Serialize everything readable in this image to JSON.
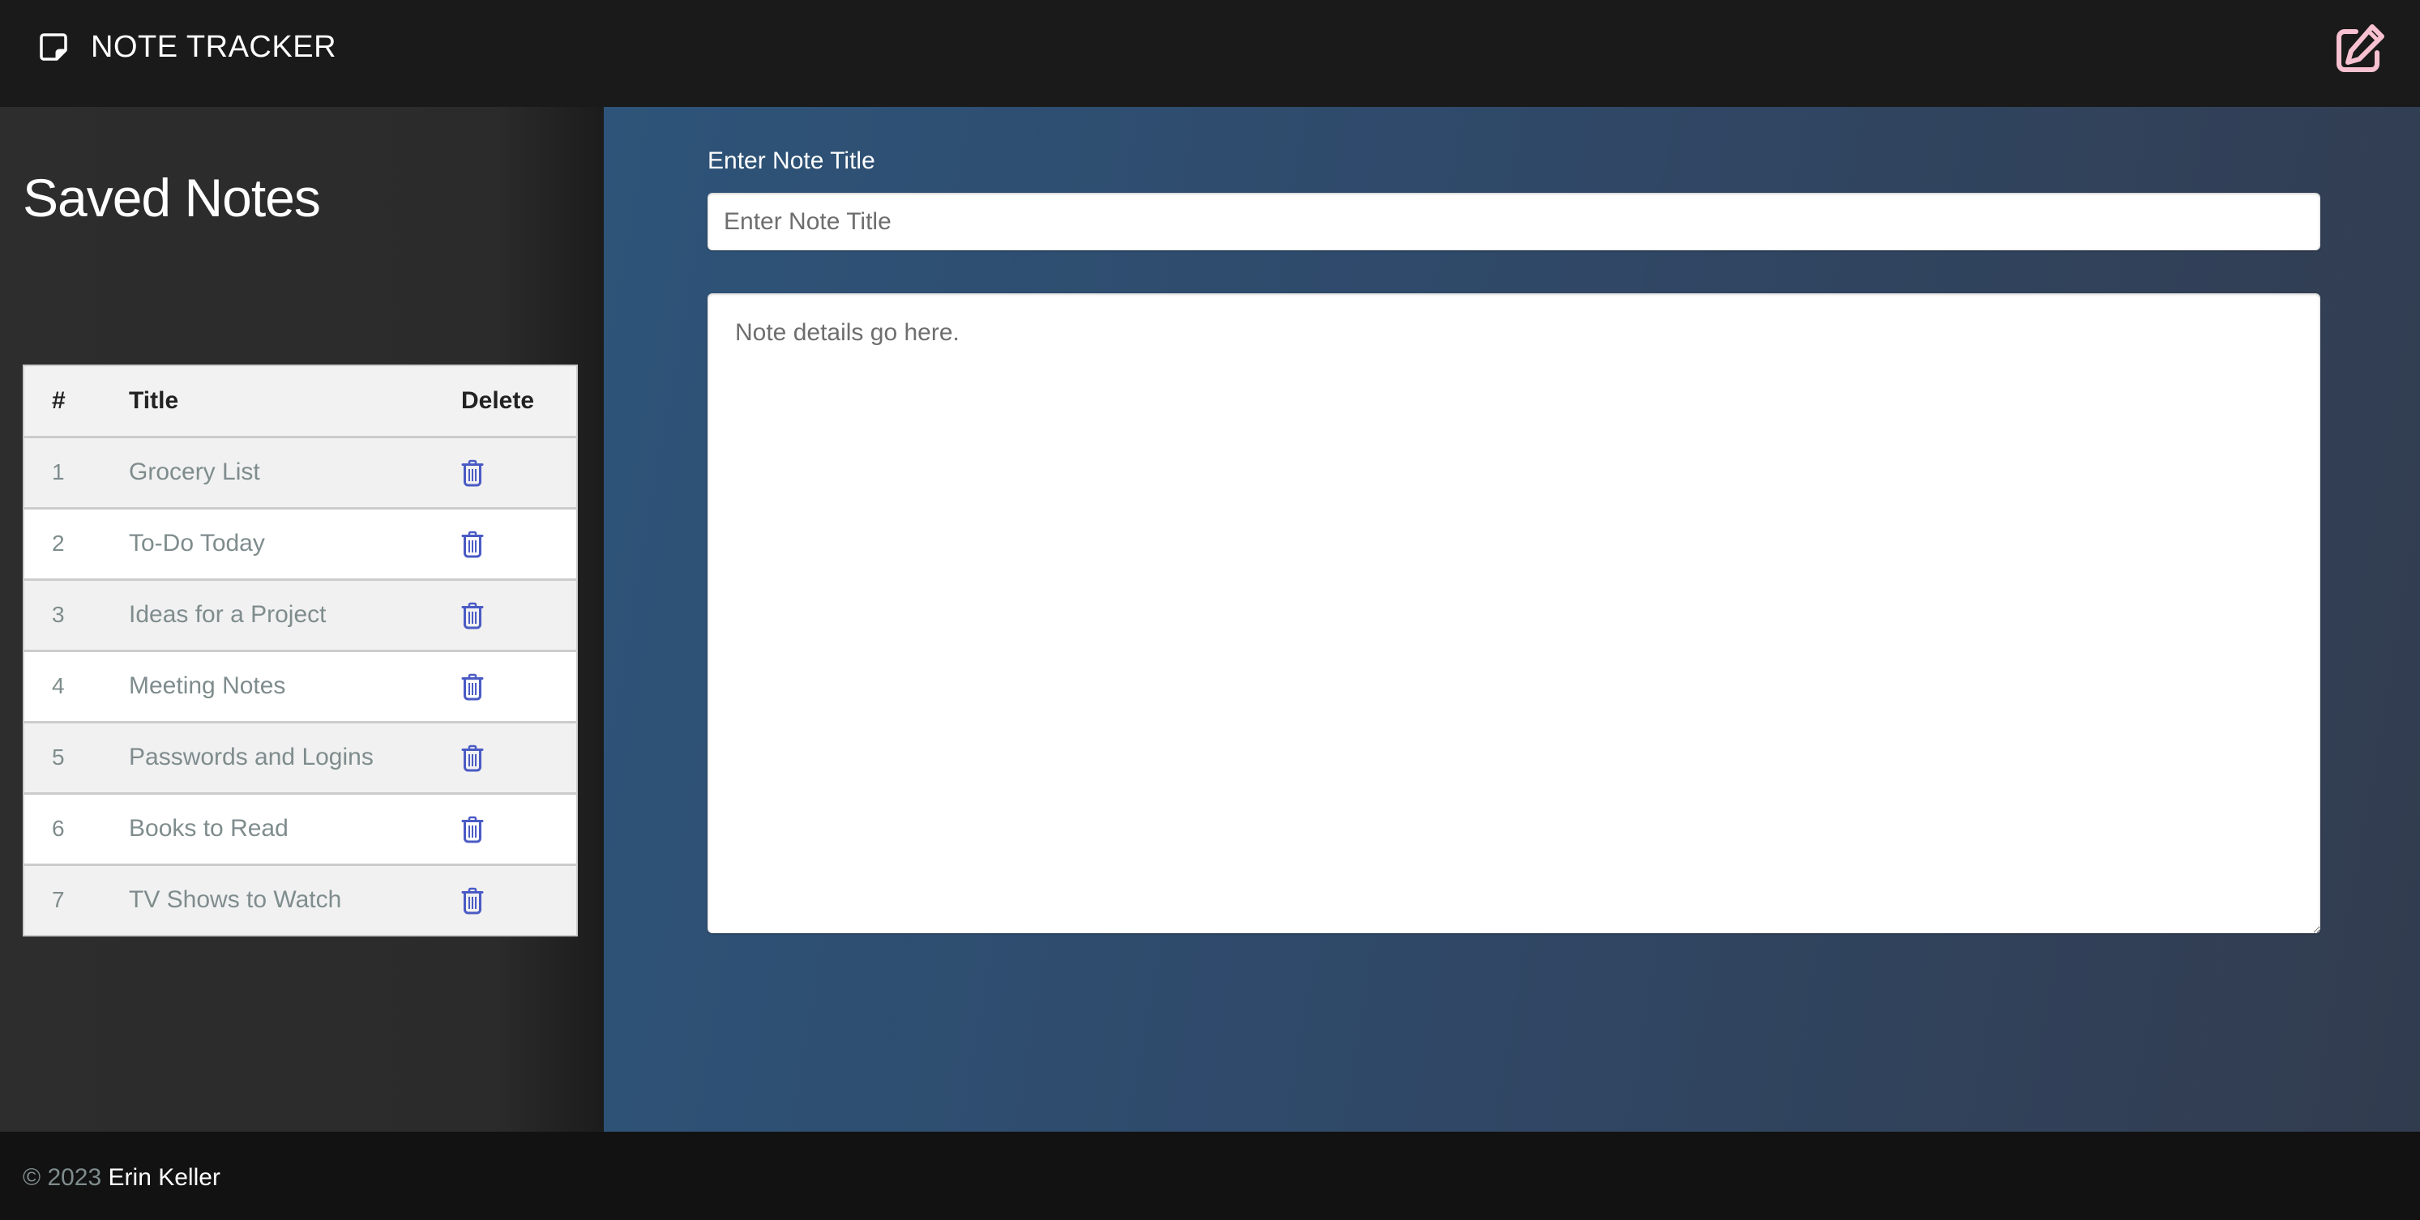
{
  "header": {
    "app_title": "NOTE TRACKER",
    "logo_icon": "sticky-note-icon",
    "new_note_icon": "pencil-square-icon",
    "new_note_icon_color": "#f8c1d1"
  },
  "sidebar": {
    "title": "Saved Notes",
    "table": {
      "columns": [
        "#",
        "Title",
        "Delete"
      ],
      "rows": [
        {
          "num": "1",
          "title": "Grocery List"
        },
        {
          "num": "2",
          "title": "To-Do Today"
        },
        {
          "num": "3",
          "title": "Ideas for a Project"
        },
        {
          "num": "4",
          "title": "Meeting Notes"
        },
        {
          "num": "5",
          "title": "Passwords and Logins"
        },
        {
          "num": "6",
          "title": "Books to Read"
        },
        {
          "num": "7",
          "title": "TV Shows to Watch"
        }
      ],
      "delete_icon": "trash-icon",
      "delete_icon_color": "#4a5bc4"
    }
  },
  "editor": {
    "title_label": "Enter Note Title",
    "title_input": {
      "value": "",
      "placeholder": "Enter Note Title"
    },
    "body_textarea": {
      "value": "",
      "placeholder": "Note details go here."
    }
  },
  "footer": {
    "copyright": "© 2023",
    "author": "Erin Keller"
  }
}
